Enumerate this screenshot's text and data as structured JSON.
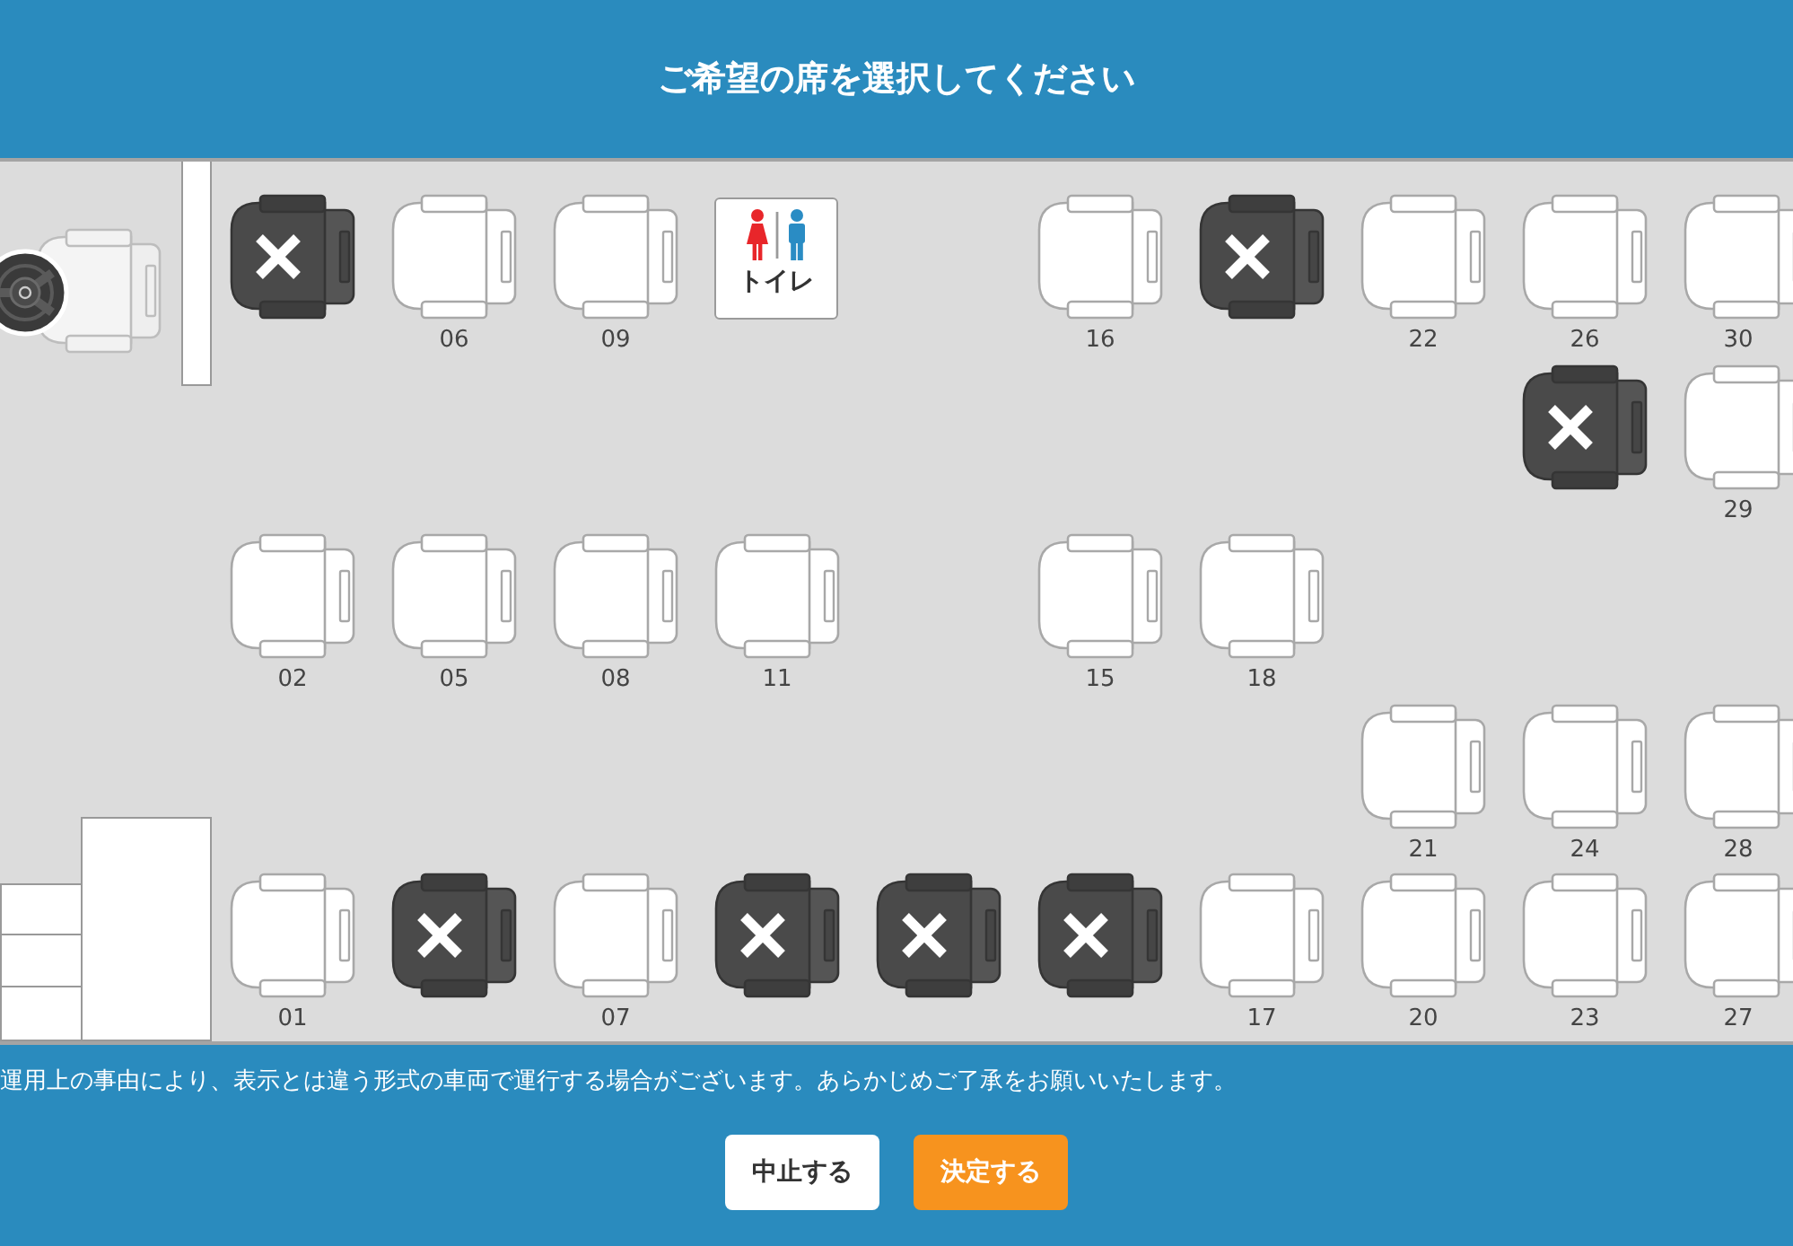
{
  "header": {
    "title": "ご希望の席を選択してください"
  },
  "seat_map": {
    "rows": [
      [
        {
          "kind": "seat",
          "taken": true
        },
        {
          "kind": "seat",
          "taken": false,
          "number": "06"
        },
        {
          "kind": "seat",
          "taken": false,
          "number": "09"
        },
        {
          "kind": "toilet",
          "label": "トイレ"
        },
        {
          "kind": "gap"
        },
        {
          "kind": "seat",
          "taken": false,
          "number": "16"
        },
        {
          "kind": "seat",
          "taken": true
        },
        {
          "kind": "seat",
          "taken": false,
          "number": "22"
        },
        {
          "kind": "seat",
          "taken": false,
          "number": "26"
        },
        {
          "kind": "seat",
          "taken": false,
          "number": "30"
        }
      ],
      [
        {
          "kind": "gap"
        },
        {
          "kind": "gap"
        },
        {
          "kind": "gap"
        },
        {
          "kind": "gap"
        },
        {
          "kind": "gap"
        },
        {
          "kind": "gap"
        },
        {
          "kind": "gap"
        },
        {
          "kind": "gap"
        },
        {
          "kind": "seat",
          "taken": true
        },
        {
          "kind": "seat",
          "taken": false,
          "number": "29"
        }
      ],
      [
        {
          "kind": "seat",
          "taken": false,
          "number": "02"
        },
        {
          "kind": "seat",
          "taken": false,
          "number": "05"
        },
        {
          "kind": "seat",
          "taken": false,
          "number": "08"
        },
        {
          "kind": "seat",
          "taken": false,
          "number": "11"
        },
        {
          "kind": "gap"
        },
        {
          "kind": "seat",
          "taken": false,
          "number": "15"
        },
        {
          "kind": "seat",
          "taken": false,
          "number": "18"
        }
      ],
      [
        {
          "kind": "gap"
        },
        {
          "kind": "gap"
        },
        {
          "kind": "gap"
        },
        {
          "kind": "gap"
        },
        {
          "kind": "gap"
        },
        {
          "kind": "gap"
        },
        {
          "kind": "gap"
        },
        {
          "kind": "seat",
          "taken": false,
          "number": "21"
        },
        {
          "kind": "seat",
          "taken": false,
          "number": "24"
        },
        {
          "kind": "seat",
          "taken": false,
          "number": "28"
        }
      ],
      [
        {
          "kind": "seat",
          "taken": false,
          "number": "01"
        },
        {
          "kind": "seat",
          "taken": true
        },
        {
          "kind": "seat",
          "taken": false,
          "number": "07"
        },
        {
          "kind": "seat",
          "taken": true
        },
        {
          "kind": "seat",
          "taken": true
        },
        {
          "kind": "seat",
          "taken": true
        },
        {
          "kind": "seat",
          "taken": false,
          "number": "17"
        },
        {
          "kind": "seat",
          "taken": false,
          "number": "20"
        },
        {
          "kind": "seat",
          "taken": false,
          "number": "23"
        },
        {
          "kind": "seat",
          "taken": false,
          "number": "27"
        }
      ]
    ]
  },
  "notice": "運用上の事由により、表示とは違う形式の車両で運行する場合がございます。あらかじめご了承をお願いいたします。",
  "buttons": [
    {
      "label": "中止する",
      "kind": "secondary"
    },
    {
      "label": "決定する",
      "kind": "primary"
    }
  ]
}
